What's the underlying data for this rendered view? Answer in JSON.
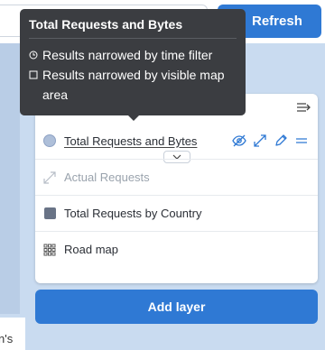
{
  "toolbar": {
    "refresh_label": "Refresh"
  },
  "tooltip": {
    "title": "Total Requests and Bytes",
    "lines": [
      "Results narrowed by time filter",
      "Results narrowed by visible map area"
    ]
  },
  "layers": [
    {
      "label": "Total Requests and Bytes",
      "swatch": "circle",
      "color": "#aebfd9"
    },
    {
      "label": "Actual Requests",
      "swatch": "line-icon"
    },
    {
      "label": "Total Requests by Country",
      "swatch": "square",
      "color": "#697386"
    },
    {
      "label": "Road map",
      "swatch": "grid-icon"
    }
  ],
  "add_layer_label": "Add layer",
  "partial_text": "n's",
  "colors": {
    "accent": "#2f79d4",
    "map_bg": "#c9dbf0",
    "tooltip_bg": "#3b3d41"
  }
}
